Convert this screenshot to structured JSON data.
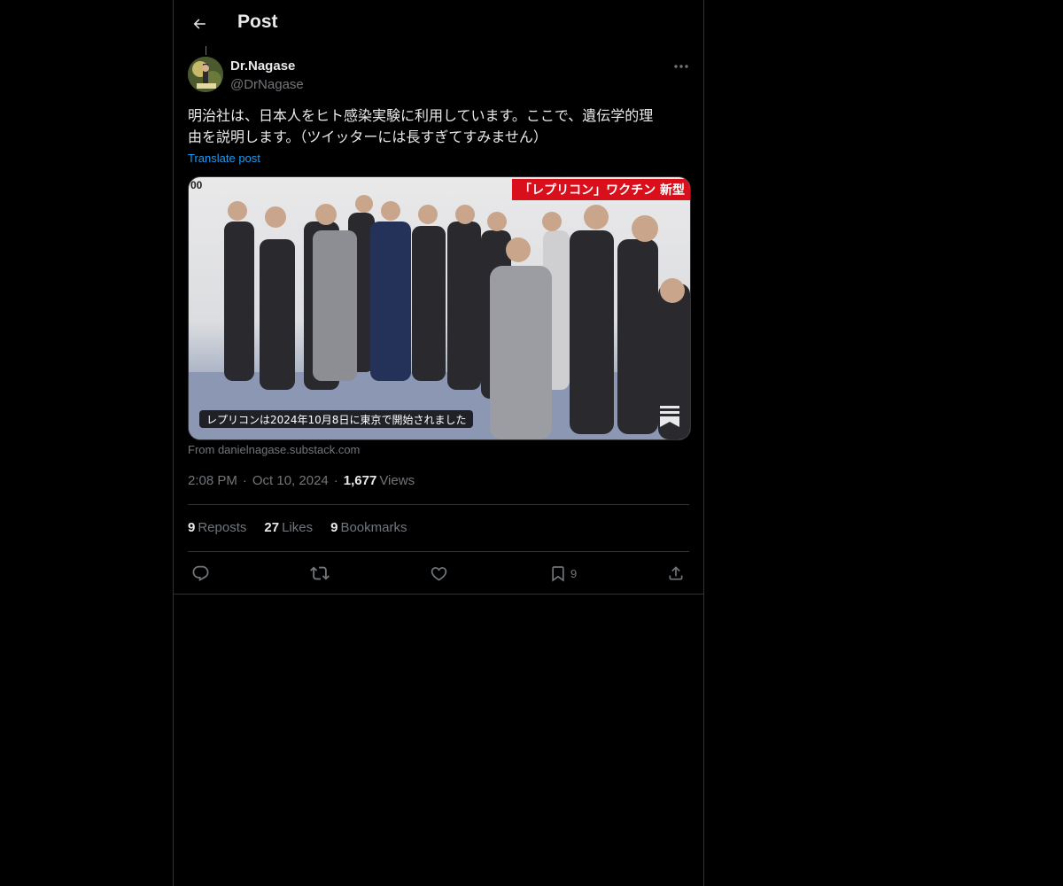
{
  "header": {
    "title": "Post",
    "back_icon": "arrow-left-icon"
  },
  "author": {
    "name": "Dr.Nagase",
    "handle": "@DrNagase"
  },
  "post": {
    "text": "明治社は、日本人をヒト感染実験に利用しています。ここで、遺伝学的理\n由を説明します。（ツイッターには長すぎてすみません）",
    "translate_label": "Translate post",
    "media": {
      "banner_text": "「レプリコン」ワクチン 新型",
      "corner_text": "00",
      "caption": "レプリコンは2024年10月8日に東京で開始されました"
    },
    "media_source": "From danielnagase.substack.com",
    "time": "2:08 PM",
    "date": "Oct 10, 2024",
    "views_count": "1,677",
    "views_label": "Views",
    "separator": "·"
  },
  "stats": {
    "reposts_count": "9",
    "reposts_label": "Reposts",
    "likes_count": "27",
    "likes_label": "Likes",
    "bookmarks_count": "9",
    "bookmarks_label": "Bookmarks"
  },
  "actions": {
    "bookmark_count": "9"
  },
  "colors": {
    "background": "#000000",
    "text": "#e7e9ea",
    "muted": "#71767b",
    "accent": "#1d9bf0",
    "border": "#2f3336"
  }
}
